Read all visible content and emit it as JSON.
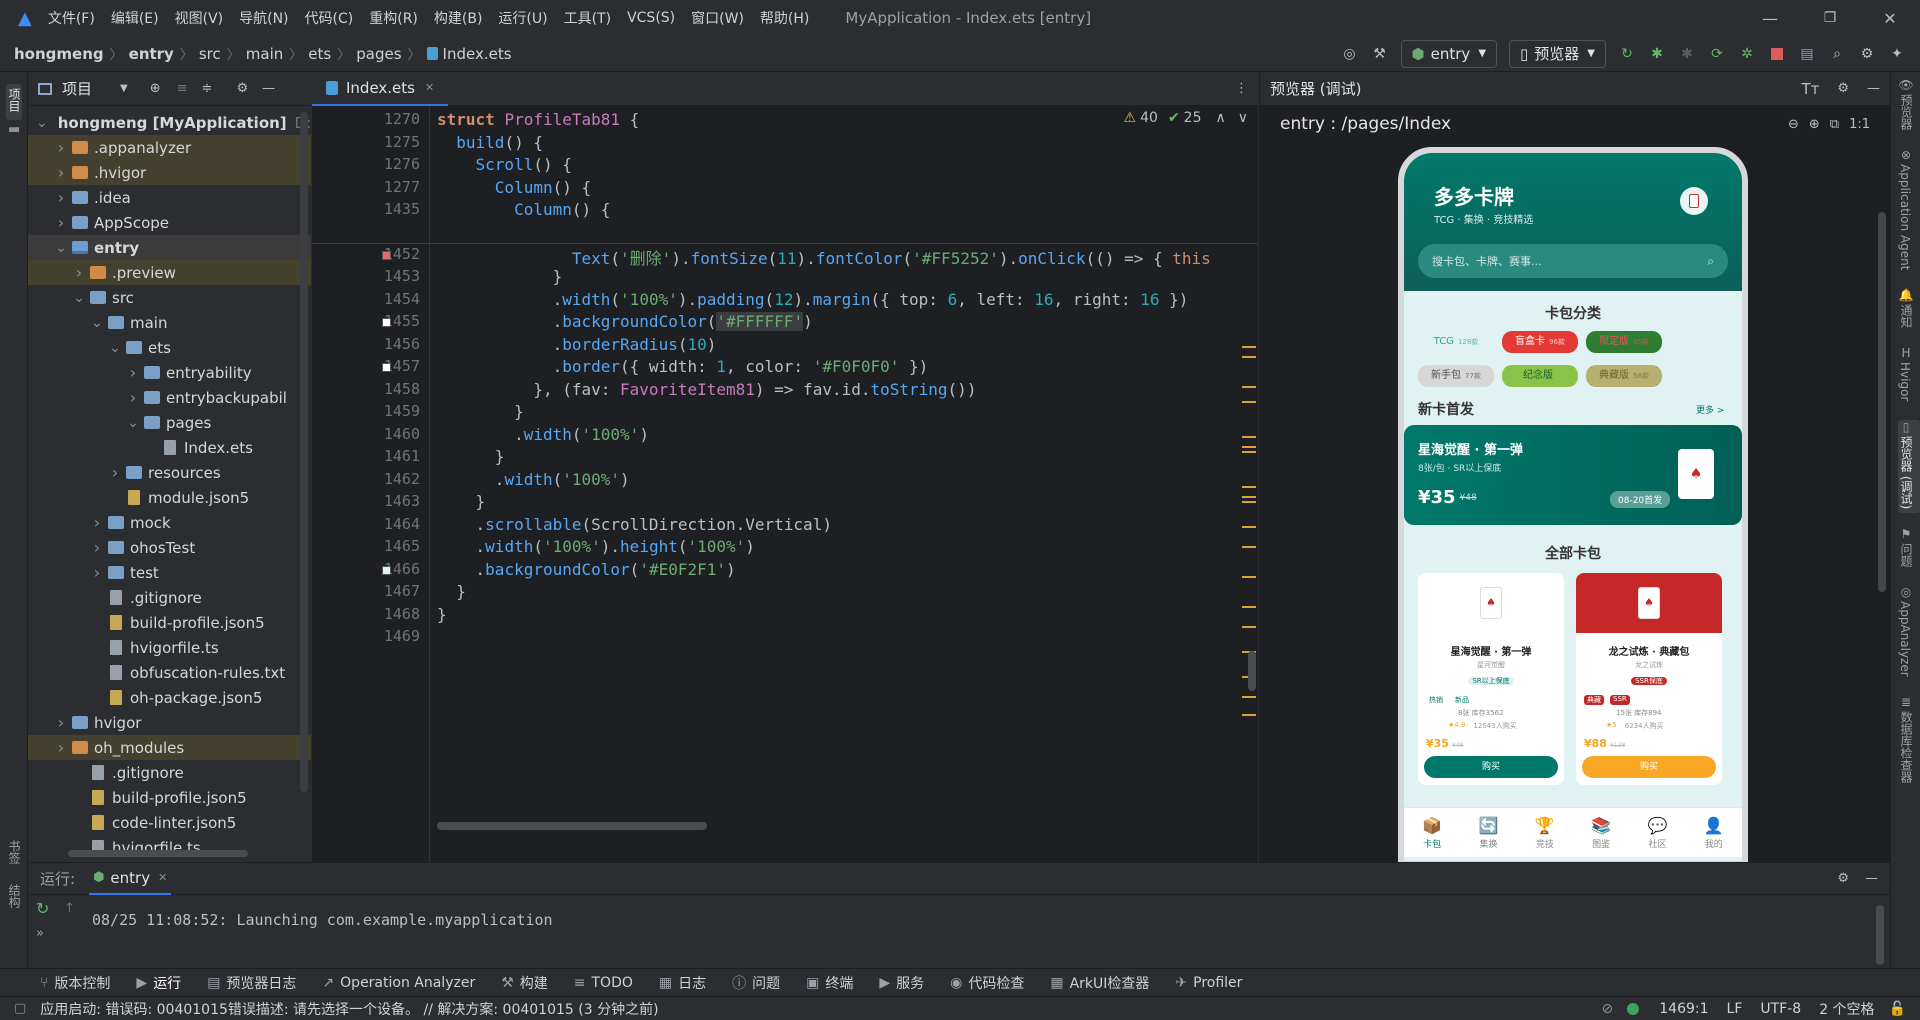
{
  "window": {
    "title": "MyApplication - Index.ets [entry]",
    "menu": [
      "文件(F)",
      "编辑(E)",
      "视图(V)",
      "导航(N)",
      "代码(C)",
      "重构(R)",
      "构建(B)",
      "运行(U)",
      "工具(T)",
      "VCS(S)",
      "窗口(W)",
      "帮助(H)"
    ]
  },
  "breadcrumb": [
    "hongmeng",
    "entry",
    "src",
    "main",
    "ets",
    "pages",
    "Index.ets"
  ],
  "toolbar": {
    "config_label": "entry",
    "device_label": "预览器"
  },
  "left_strip": {
    "project_label": "项目",
    "bookmarks_label": "书签",
    "structure_label": "结构"
  },
  "right_strip": [
    "预览器",
    "Application Agent",
    "通知",
    "Hvigor",
    "预览器 (调试)",
    "问题",
    "AppAnalyzer",
    "数据库检查器"
  ],
  "project": {
    "title": "项目",
    "tree": [
      {
        "label": "hongmeng [MyApplication]",
        "suffix": "D:",
        "depth": 0,
        "arrow": "v",
        "icon": "folder-mod",
        "style": ""
      },
      {
        "label": ".appanalyzer",
        "depth": 1,
        "arrow": ">",
        "icon": "folder-orange",
        "style": "hl"
      },
      {
        "label": ".hvigor",
        "depth": 1,
        "arrow": ">",
        "icon": "folder-orange",
        "style": "hl"
      },
      {
        "label": ".idea",
        "depth": 1,
        "arrow": ">",
        "icon": "folder",
        "style": ""
      },
      {
        "label": "AppScope",
        "depth": 1,
        "arrow": ">",
        "icon": "folder",
        "style": ""
      },
      {
        "label": "entry",
        "depth": 1,
        "arrow": "v",
        "icon": "folder-mod",
        "style": "sel"
      },
      {
        "label": ".preview",
        "depth": 2,
        "arrow": ">",
        "icon": "folder-orange",
        "style": "hl"
      },
      {
        "label": "src",
        "depth": 2,
        "arrow": "v",
        "icon": "folder",
        "style": ""
      },
      {
        "label": "main",
        "depth": 3,
        "arrow": "v",
        "icon": "folder",
        "style": ""
      },
      {
        "label": "ets",
        "depth": 4,
        "arrow": "v",
        "icon": "folder",
        "style": ""
      },
      {
        "label": "entryability",
        "depth": 5,
        "arrow": ">",
        "icon": "folder",
        "style": ""
      },
      {
        "label": "entrybackupabil",
        "depth": 5,
        "arrow": ">",
        "icon": "folder",
        "style": ""
      },
      {
        "label": "pages",
        "depth": 5,
        "arrow": "v",
        "icon": "folder",
        "style": ""
      },
      {
        "label": "Index.ets",
        "depth": 6,
        "arrow": "",
        "icon": "file",
        "style": ""
      },
      {
        "label": "resources",
        "depth": 4,
        "arrow": ">",
        "icon": "folder",
        "style": ""
      },
      {
        "label": "module.json5",
        "depth": 4,
        "arrow": "",
        "icon": "json",
        "style": ""
      },
      {
        "label": "mock",
        "depth": 3,
        "arrow": ">",
        "icon": "folder",
        "style": ""
      },
      {
        "label": "ohosTest",
        "depth": 3,
        "arrow": ">",
        "icon": "folder",
        "style": ""
      },
      {
        "label": "test",
        "depth": 3,
        "arrow": ">",
        "icon": "folder",
        "style": ""
      },
      {
        "label": ".gitignore",
        "depth": 3,
        "arrow": "",
        "icon": "file",
        "style": ""
      },
      {
        "label": "build-profile.json5",
        "depth": 3,
        "arrow": "",
        "icon": "json",
        "style": ""
      },
      {
        "label": "hvigorfile.ts",
        "depth": 3,
        "arrow": "",
        "icon": "file",
        "style": ""
      },
      {
        "label": "obfuscation-rules.txt",
        "depth": 3,
        "arrow": "",
        "icon": "file",
        "style": ""
      },
      {
        "label": "oh-package.json5",
        "depth": 3,
        "arrow": "",
        "icon": "json",
        "style": ""
      },
      {
        "label": "hvigor",
        "depth": 1,
        "arrow": ">",
        "icon": "folder",
        "style": ""
      },
      {
        "label": "oh_modules",
        "depth": 1,
        "arrow": ">",
        "icon": "folder-orange",
        "style": "hl"
      },
      {
        "label": ".gitignore",
        "depth": 2,
        "arrow": "",
        "icon": "file",
        "style": ""
      },
      {
        "label": "build-profile.json5",
        "depth": 2,
        "arrow": "",
        "icon": "json",
        "style": ""
      },
      {
        "label": "code-linter.json5",
        "depth": 2,
        "arrow": "",
        "icon": "json",
        "style": ""
      },
      {
        "label": "hvigorfile.ts",
        "depth": 2,
        "arrow": "",
        "icon": "file",
        "style": ""
      }
    ]
  },
  "editor": {
    "tab": "Index.ets",
    "warnings": "40",
    "checks": "25",
    "sticky": [
      {
        "line": "1270",
        "html": "<span class=\"kw\">struct</span> <span class=\"typ\">ProfileTab81</span> {"
      },
      {
        "line": "1275",
        "html": "  <span class=\"fn\">build</span>() {"
      },
      {
        "line": "1276",
        "html": "    <span class=\"fn\">Scroll</span>() {"
      },
      {
        "line": "1277",
        "html": "      <span class=\"fn\">Column</span>() {"
      },
      {
        "line": "1435",
        "html": "        <span class=\"fn\">Column</span>() {"
      }
    ],
    "lines": [
      {
        "line": "1451",
        "html": ""
      },
      {
        "line": "1452",
        "html": "              <span class=\"fn\">Text</span>(<span class=\"str\">'删除'</span>).<span class=\"fn\">fontSize</span>(<span class=\"num\">11</span>).<span class=\"fn\">fontColor</span>(<span class=\"str\">'#FF5252'</span>).<span class=\"fn\">onClick</span>(() => { <span class=\"kw\">this</span>"
      },
      {
        "line": "1453",
        "html": "            }"
      },
      {
        "line": "1454",
        "html": "            .<span class=\"fn\">width</span>(<span class=\"str\">'100%'</span>).<span class=\"fn\">padding</span>(<span class=\"num\">12</span>).<span class=\"fn\">margin</span>({ top: <span class=\"num\">6</span>, left: <span class=\"num\">16</span>, right: <span class=\"num\">16</span> })"
      },
      {
        "line": "1455",
        "html": "            .<span class=\"fn\">backgroundColor</span>(<span class=\"str\" style=\"background:#3b3d41\">'#FFFFFF'</span>)"
      },
      {
        "line": "1456",
        "html": "            .<span class=\"fn\">borderRadius</span>(<span class=\"num\">10</span>)"
      },
      {
        "line": "1457",
        "html": "            .<span class=\"fn\">border</span>({ width: <span class=\"num\">1</span>, color: <span class=\"str\">'#F0F0F0'</span> })"
      },
      {
        "line": "1458",
        "html": "          }, (fav: <span class=\"typ\">FavoriteItem81</span>) => fav.id.<span class=\"fn\">toString</span>())"
      },
      {
        "line": "1459",
        "html": "        }"
      },
      {
        "line": "1460",
        "html": "        .<span class=\"fn\">width</span>(<span class=\"str\">'100%'</span>)"
      },
      {
        "line": "1461",
        "html": "      }"
      },
      {
        "line": "1462",
        "html": "      .<span class=\"fn\">width</span>(<span class=\"str\">'100%'</span>)"
      },
      {
        "line": "1463",
        "html": "    }"
      },
      {
        "line": "1464",
        "html": "    .<span class=\"fn\">scrollable</span>(ScrollDirection.Vertical)"
      },
      {
        "line": "1465",
        "html": "    .<span class=\"fn\">width</span>(<span class=\"str\">'100%'</span>).<span class=\"fn\">height</span>(<span class=\"str\">'100%'</span>)"
      },
      {
        "line": "1466",
        "html": "    .<span class=\"fn\">backgroundColor</span>(<span class=\"str\">'#E0F2F1'</span>)"
      },
      {
        "line": "1467",
        "html": "  }"
      },
      {
        "line": "1468",
        "html": "}"
      },
      {
        "line": "1469",
        "html": ""
      }
    ]
  },
  "preview": {
    "title": "预览器 (调试)",
    "route": "entry : /pages/Index",
    "app": {
      "name": "多多卡牌",
      "subtitle": "TCG · 集换 · 竞技精选",
      "search_placeholder": "搜卡包、卡牌、赛事...",
      "category_title": "卡包分类",
      "chips_row1": [
        {
          "label": "TCG",
          "count": "128款",
          "bg": "#e0f2f1",
          "fg": "#26a69a"
        },
        {
          "label": "盲盒卡",
          "count": "96款",
          "bg": "#e53935",
          "fg": "#ffffff"
        },
        {
          "label": "限定版",
          "count": "85款",
          "bg": "#2e7d32",
          "fg": "#ef5350"
        }
      ],
      "chips_row2": [
        {
          "label": "新手包",
          "count": "77款",
          "bg": "#d7d7d7",
          "fg": "#4e4e4e"
        },
        {
          "label": "纪念版",
          "count": "",
          "bg": "#8bc34a",
          "fg": "#1b5e20"
        },
        {
          "label": "典藏版",
          "count": "58款",
          "bg": "#b8b070",
          "fg": "#6d5f2b"
        }
      ],
      "new_title": "新卡首发",
      "more": "更多 >",
      "banner": {
        "title": "星海觉醒 · 第一弹",
        "sub": "8张/包 · SR以上保底",
        "price": "¥35",
        "old": "¥48",
        "date": "08-20首发"
      },
      "all_title": "全部卡包",
      "cards": [
        {
          "name": "星海觉醒 · 第一弹",
          "series": "星河觉醒",
          "guarantee": "SR以上保底",
          "tags": [
            "热销",
            "新品"
          ],
          "info": "8张  库存3562",
          "rating": "★4.9",
          "sold": "12543人购买",
          "price": "¥35",
          "old": "¥48",
          "btn": "购买"
        },
        {
          "name": "龙之试炼 · 典藏包",
          "series": "龙之试炼",
          "guarantee": "SSR保底",
          "tags": [
            "典藏",
            "SSR"
          ],
          "info": "15张  库存894",
          "rating": "★5",
          "sold": "6234人购买",
          "price": "¥88",
          "old": "¥128",
          "btn": "购买"
        }
      ],
      "nav": [
        {
          "label": "卡包",
          "icon": "📦"
        },
        {
          "label": "集换",
          "icon": "🔄"
        },
        {
          "label": "竞技",
          "icon": "🏆"
        },
        {
          "label": "图鉴",
          "icon": "📚"
        },
        {
          "label": "社区",
          "icon": "💬"
        },
        {
          "label": "我的",
          "icon": "👤"
        }
      ]
    }
  },
  "run": {
    "label": "运行:",
    "tab": "entry",
    "log": "08/25 11:08:52: Launching com.example.myapplication"
  },
  "bottom_tools": [
    "版本控制",
    "运行",
    "预览器日志",
    "Operation Analyzer",
    "构建",
    "TODO",
    "日志",
    "问题",
    "终端",
    "服务",
    "代码检查",
    "ArkUI检查器",
    "Profiler"
  ],
  "status": {
    "message": "应用启动: 错误码: 00401015错误描述: 请先选择一个设备。 // 解决方案: 00401015 (3 分钟之前)",
    "position": "1469:1",
    "line_sep": "LF",
    "encoding": "UTF-8",
    "indent": "2 个空格"
  }
}
